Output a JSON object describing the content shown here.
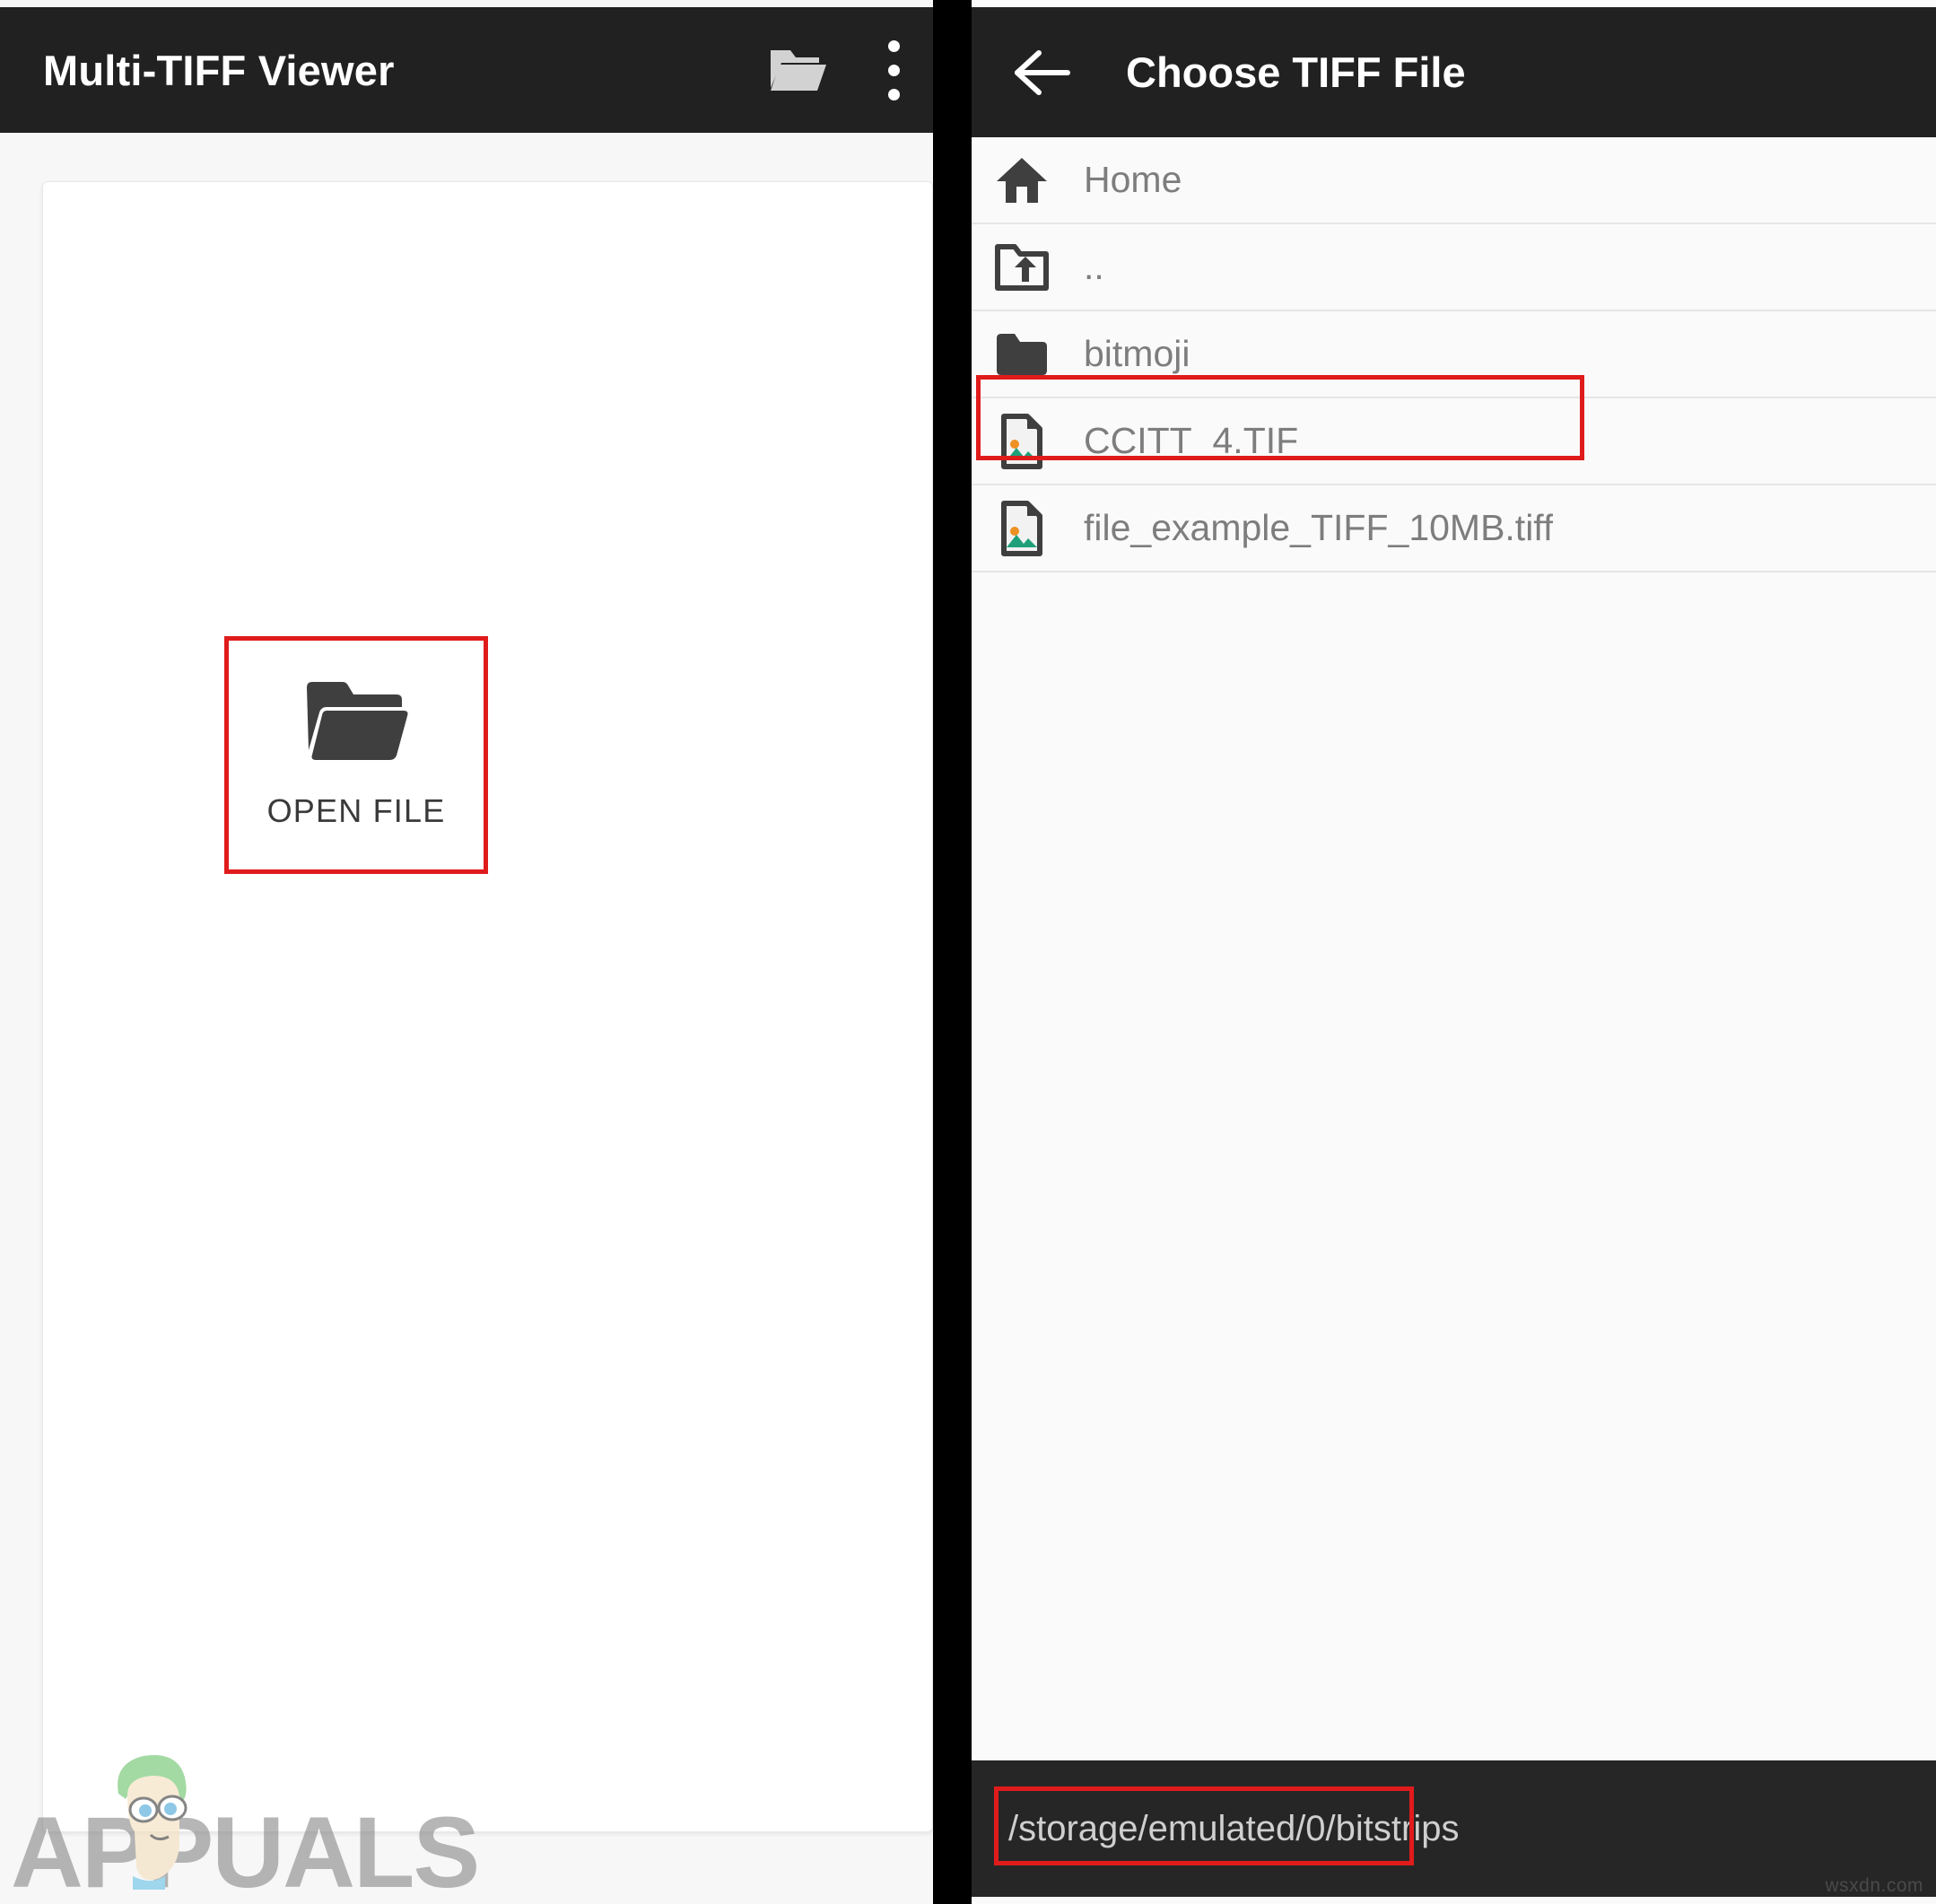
{
  "viewer": {
    "app_title": "Multi-TIFF Viewer",
    "toolbar_icons": {
      "open_folder": "folder-open-icon",
      "overflow": "overflow-menu-icon"
    },
    "open_file_button": {
      "label": "OPEN FILE",
      "icon": "folder-open-icon",
      "highlighted": "true"
    },
    "watermark": "APPUALS"
  },
  "chooser": {
    "title": "Choose TIFF File",
    "back_icon": "arrow-left-icon",
    "items": [
      {
        "label": "Home",
        "icon": "home-icon",
        "type": "shortcut",
        "highlighted": "false"
      },
      {
        "label": "..",
        "icon": "folder-up-icon",
        "type": "parent",
        "highlighted": "false"
      },
      {
        "label": "bitmoji",
        "icon": "folder-icon",
        "type": "folder",
        "highlighted": "false"
      },
      {
        "label": "CCITT_4.TIF",
        "icon": "image-file-icon",
        "type": "file",
        "highlighted": "true"
      },
      {
        "label": "file_example_TIFF_10MB.tiff",
        "icon": "image-file-icon",
        "type": "file",
        "highlighted": "false"
      }
    ],
    "path": "/storage/emulated/0/bitstrips",
    "path_highlighted": "true"
  },
  "page_watermark": "wsxdn.com",
  "colors": {
    "toolbar_bg": "#212121",
    "panel_bg": "#fafafa",
    "highlight_red": "#e01b1b",
    "icon_dark": "#3c3c3c",
    "label_gray": "#7d7d7d",
    "path_bar_bg": "#262626"
  }
}
